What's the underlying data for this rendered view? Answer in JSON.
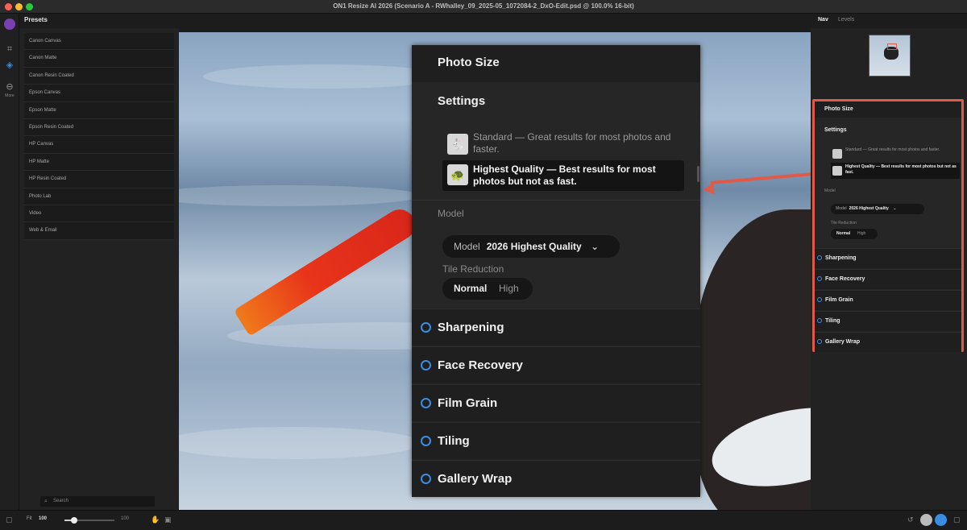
{
  "window": {
    "title": "ON1 Resize AI 2026 (Scenario A - RWhalley_09_2025-05_1072084-2_DxO-Edit.psd @ 100.0% 16-bit)"
  },
  "toolstrip": {
    "more_label": "More"
  },
  "presets": {
    "tab_label": "Presets",
    "items": [
      "Canon Canvas",
      "Canon Matte",
      "Canon Resin Coated",
      "Epson Canvas",
      "Epson Matte",
      "Epson Resin Coated",
      "HP Canvas",
      "HP Matte",
      "HP Resin Coated",
      "Photo Lab",
      "Video",
      "Web & Email"
    ],
    "search_placeholder": "Search"
  },
  "callout": {
    "photo_size": "Photo Size",
    "settings": "Settings",
    "standard": "Standard — Great results for most photos and faster.",
    "highest_quality": "Highest Quality — Best results for most photos but not as fast.",
    "model_header": "Model",
    "model_label": "Model",
    "model_value": "2026 Highest Quality",
    "tile_reduction": "Tile Reduction",
    "tile_normal": "Normal",
    "tile_high": "High",
    "sections": [
      "Sharpening",
      "Face Recovery",
      "Film Grain",
      "Tiling",
      "Gallery Wrap"
    ]
  },
  "rightpanel": {
    "tabs": [
      "Nav",
      "Levels"
    ],
    "photo_size": "Photo Size",
    "settings": "Settings",
    "standard": "Standard — Great results for most photos and faster.",
    "highest_quality": "Highest Quality — Best results for most photos but not as fast.",
    "model_header": "Model",
    "model_label": "Model",
    "model_value": "2026 Highest Quality",
    "tile_reduction": "Tile Reduction",
    "tile_normal": "Normal",
    "tile_high": "High",
    "sections": [
      "Sharpening",
      "Face Recovery",
      "Film Grain",
      "Tiling",
      "Gallery Wrap"
    ]
  },
  "bottombar": {
    "fit_label": "Fit",
    "zoom_value": "100",
    "zoom_max": "100",
    "zoom_fraction": 0.2
  },
  "colors": {
    "accent_blue": "#3a8de0",
    "callout_red": "#e05a4a",
    "app_purple": "#7a3fb0"
  }
}
